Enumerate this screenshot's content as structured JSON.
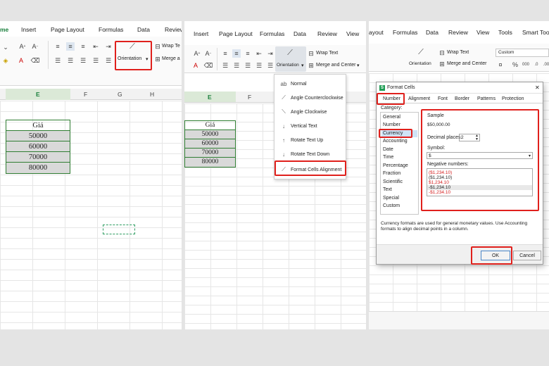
{
  "panel1": {
    "tabs": [
      "me",
      "Insert",
      "Page Layout",
      "Formulas",
      "Data",
      "Review"
    ],
    "orientation_label": "Orientation",
    "wrap_label": "Wrap Te",
    "merge_label": "Merge a",
    "columns": [
      "E",
      "F",
      "G",
      "H"
    ],
    "cells": [
      "Giá",
      "50000",
      "60000",
      "70000",
      "80000"
    ]
  },
  "panel2": {
    "tabs": [
      "Insert",
      "Page Layout",
      "Formulas",
      "Data",
      "Review",
      "View"
    ],
    "orientation_label": "Orientation",
    "wrap_label": "Wrap Text",
    "merge_label": "Merge and Center",
    "columns": [
      "E",
      "F"
    ],
    "cells": [
      "Giá",
      "50000",
      "60000",
      "70000",
      "80000"
    ],
    "menu": [
      "Normal",
      "Angle Counterclockwise",
      "Angle Clockwise",
      "Vertical Text",
      "Rotate Text Up",
      "Rotate Text Down",
      "Format Cells Alignment"
    ]
  },
  "panel3": {
    "tabs": [
      "ayout",
      "Formulas",
      "Data",
      "Review",
      "View",
      "Tools",
      "Smart Toolb"
    ],
    "orientation_label": "Orientation",
    "wrap_label": "Wrap Text",
    "merge_label": "Merge and Center",
    "format_value": "Custom",
    "dialog": {
      "title": "Format Cells",
      "tabs": [
        "Number",
        "Alignment",
        "Font",
        "Border",
        "Patterns",
        "Protection"
      ],
      "category_label": "Category:",
      "categories": [
        "General",
        "Number",
        "Currency",
        "Accounting",
        "Date",
        "Time",
        "Percentage",
        "Fraction",
        "Scientific",
        "Text",
        "Special",
        "Custom"
      ],
      "sample_label": "Sample",
      "sample_value": "$50,000.00",
      "decimal_label": "Decimal places:",
      "decimal_value": "2",
      "symbol_label": "Symbol:",
      "symbol_value": "$",
      "negative_label": "Negative numbers:",
      "negative_options": [
        "($1,234.10)",
        "($1,234.10)",
        "$1,234.10",
        "-$1,234.10",
        "-$1,234.10"
      ],
      "description": "Currency formats are used for general monetary values. Use Accounting formats to align decimal points in a column.",
      "ok_label": "OK",
      "cancel_label": "Cancel"
    }
  },
  "colors": {
    "highlight": "#e0201c",
    "cell_border": "#2f7d32",
    "negative_red": "#d42020"
  }
}
